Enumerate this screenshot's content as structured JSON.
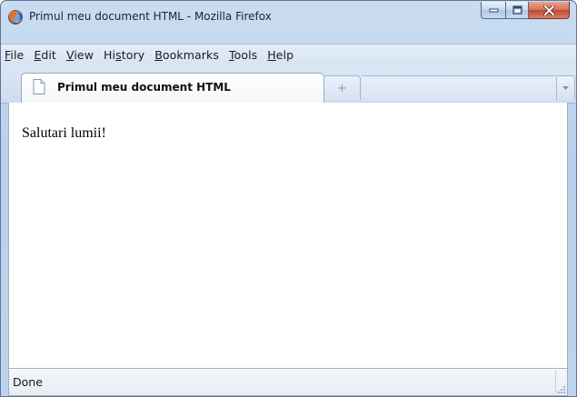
{
  "window": {
    "title": "Primul meu document HTML - Mozilla Firefox",
    "app_icon": "firefox-icon",
    "buttons": {
      "minimize_icon": "minimize-icon",
      "maximize_icon": "maximize-icon",
      "close_icon": "close-icon"
    }
  },
  "menu": {
    "items": [
      {
        "accel": "F",
        "rest": "ile"
      },
      {
        "accel": "E",
        "rest": "dit"
      },
      {
        "accel": "V",
        "rest": "iew"
      },
      {
        "pre": "Hi",
        "accel": "s",
        "rest": "tory"
      },
      {
        "accel": "B",
        "rest": "ookmarks"
      },
      {
        "accel": "T",
        "rest": "ools"
      },
      {
        "accel": "H",
        "rest": "elp"
      }
    ]
  },
  "tabs": {
    "active": {
      "title": "Primul meu document HTML",
      "icon": "document-icon"
    },
    "new_tab_symbol": "+",
    "list_icon": "chevron-down-icon"
  },
  "page": {
    "text": "Salutari lumii!"
  },
  "status": {
    "text": "Done"
  },
  "colors": {
    "frame": "#b9d0ea",
    "close_button": "#c4462b",
    "content_bg": "#ffffff"
  }
}
